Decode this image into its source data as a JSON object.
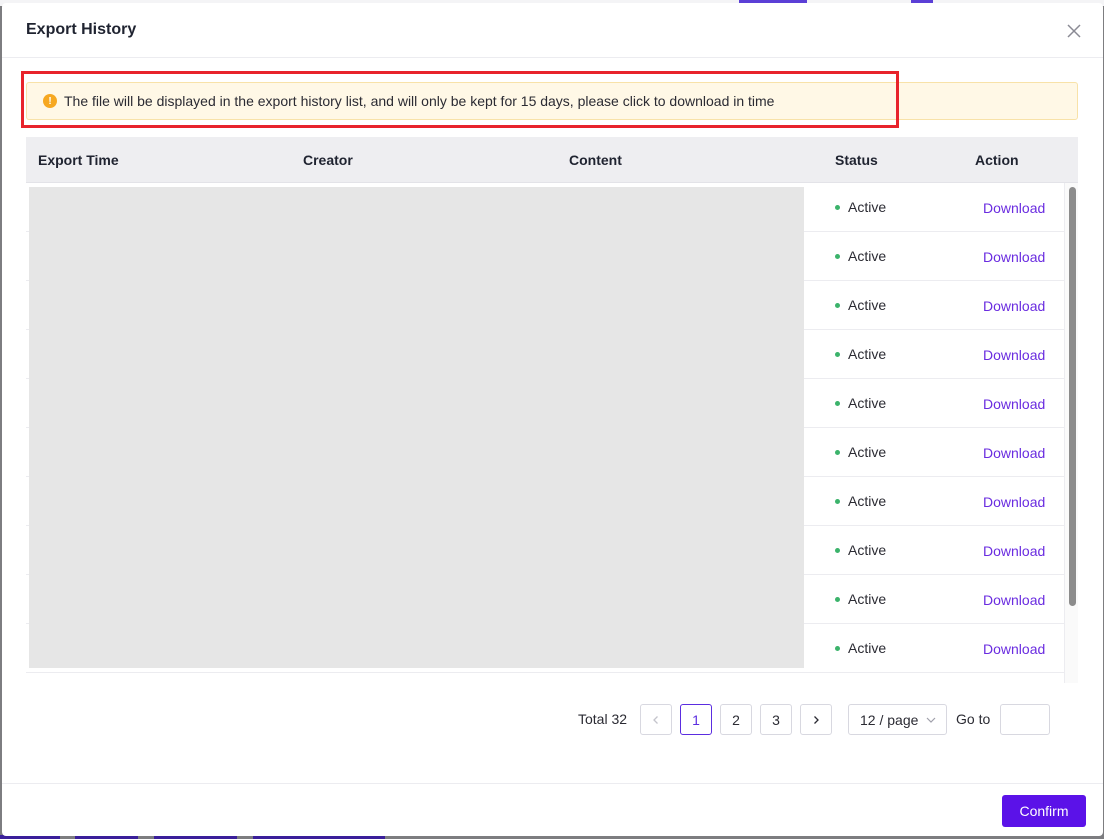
{
  "modal": {
    "title": "Export History",
    "alert_text": "The file will be displayed in the export history list, and will only be kept for 15 days, please click to download in time"
  },
  "table": {
    "columns": [
      "Export Time",
      "Creator",
      "Content",
      "Status",
      "Action"
    ],
    "rows": [
      {
        "status": "Active",
        "action": "Download"
      },
      {
        "status": "Active",
        "action": "Download"
      },
      {
        "status": "Active",
        "action": "Download"
      },
      {
        "status": "Active",
        "action": "Download"
      },
      {
        "status": "Active",
        "action": "Download"
      },
      {
        "status": "Active",
        "action": "Download"
      },
      {
        "status": "Active",
        "action": "Download"
      },
      {
        "status": "Active",
        "action": "Download"
      },
      {
        "status": "Active",
        "action": "Download"
      },
      {
        "status": "Active",
        "action": "Download"
      }
    ]
  },
  "pagination": {
    "total_label": "Total 32",
    "pages": [
      "1",
      "2",
      "3"
    ],
    "current_page": "1",
    "page_size": "12 / page",
    "goto_label": "Go to",
    "goto_value": ""
  },
  "footer": {
    "confirm_label": "Confirm"
  },
  "colors": {
    "accent": "#5b12e8",
    "link": "#6a2ce0",
    "status_active": "#3bb36b",
    "alert_bg": "#fff8e6",
    "highlight": "#e8232b"
  },
  "icons": {
    "close": "close-icon",
    "alert": "warning-icon",
    "prev": "chevron-left-icon",
    "next": "chevron-right-icon",
    "select": "chevron-down-icon"
  }
}
